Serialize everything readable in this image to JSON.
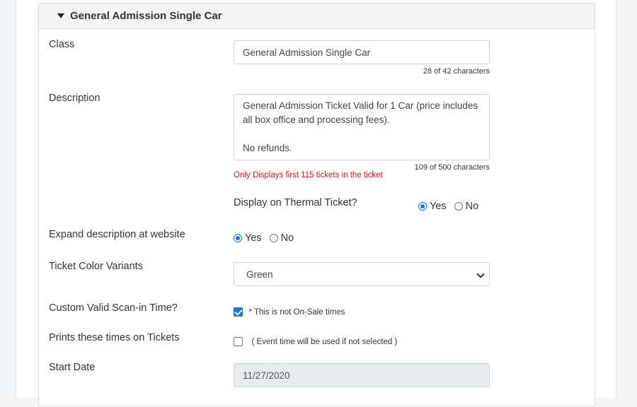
{
  "section": {
    "title": "General Admission Single Car"
  },
  "class_field": {
    "label": "Class",
    "value": "General Admission Single Car",
    "counter": "28 of 42 characters"
  },
  "description_field": {
    "label": "Description",
    "line1": "General Admission Ticket Valid for 1 Car (price includes",
    "line2": "all box office and processing fees).",
    "line3": "No refunds.",
    "counter": "109 of 500 characters",
    "warning": "Only Displays first 115 tickets in the ticket"
  },
  "thermal": {
    "label": "Display on Thermal Ticket?",
    "yes": "Yes",
    "no": "No",
    "selected": "Yes"
  },
  "expand": {
    "label": "Expand description at website",
    "yes": "Yes",
    "no": "No",
    "selected": "Yes"
  },
  "color_variants": {
    "label": "Ticket Color Variants",
    "selected": "Green"
  },
  "custom_scan": {
    "label": "Custom Valid Scan-in Time?",
    "note": "* This is not On-Sale times",
    "checked": true
  },
  "prints_times": {
    "label": "Prints these times on Tickets",
    "note": "( Event time will be used if not selected )",
    "checked": false
  },
  "start_date": {
    "label": "Start Date",
    "value": "11/27/2020"
  }
}
